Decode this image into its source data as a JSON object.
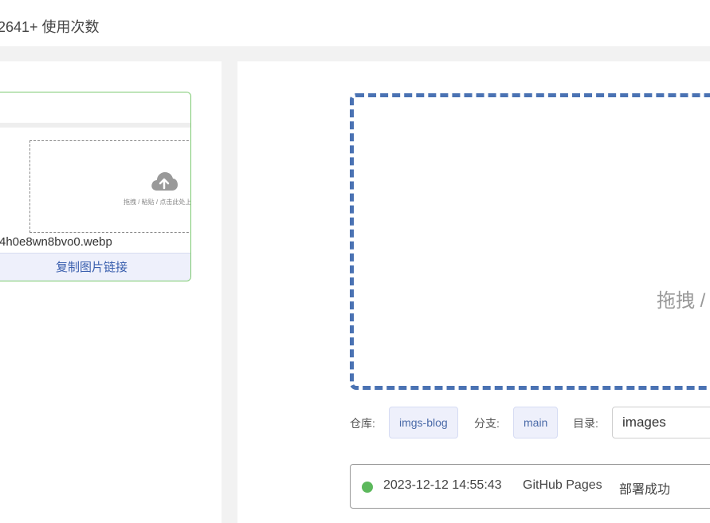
{
  "header": {
    "usage_text": "2641+ 使用次数"
  },
  "image_card": {
    "thumb_hint": "拖拽 / 粘贴 / 点击此处上传",
    "filename": "4h0e8wn8bvo0.webp",
    "copy_label": "复制图片链接"
  },
  "dropzone": {
    "text": "拖拽 /"
  },
  "repo_row": {
    "repo_label": "仓库:",
    "repo_value": "imgs-blog",
    "branch_label": "分支:",
    "branch_value": "main",
    "dir_label": "目录:",
    "dir_value": "images"
  },
  "status": {
    "timestamp": "2023-12-12 14:55:43",
    "service": "GitHub Pages",
    "result": "部署成功",
    "dot_color": "#5cb85c"
  },
  "colors": {
    "accent": "#4a72b3",
    "card_border": "#7bc96f",
    "tag_bg": "#eef0fb"
  },
  "icons": {
    "thumb_icon": "cloud-upload-icon"
  }
}
